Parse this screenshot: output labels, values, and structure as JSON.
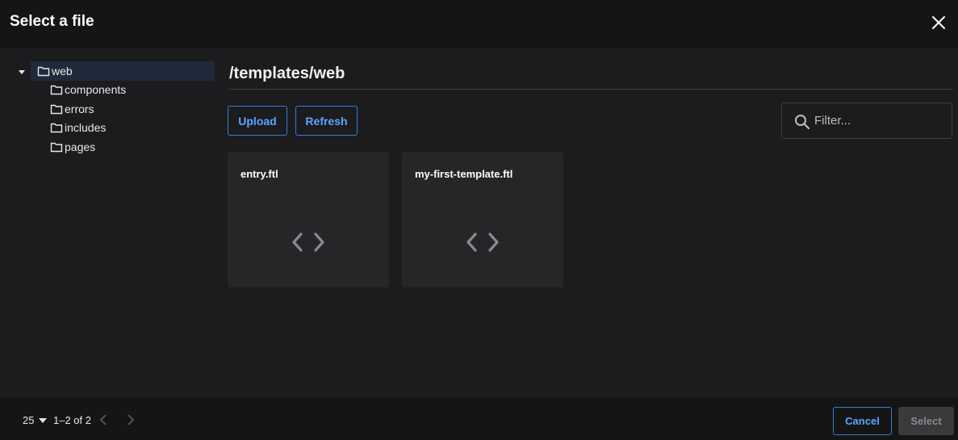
{
  "dialog": {
    "title": "Select a file"
  },
  "tree": {
    "root": {
      "label": "web",
      "expanded": true,
      "selected": true
    },
    "children": [
      {
        "label": "components"
      },
      {
        "label": "errors"
      },
      {
        "label": "includes"
      },
      {
        "label": "pages"
      }
    ]
  },
  "main": {
    "path": "/templates/web",
    "upload_label": "Upload",
    "refresh_label": "Refresh",
    "filter_placeholder": "Filter...",
    "files": [
      {
        "name": "entry.ftl",
        "icon": "code-icon"
      },
      {
        "name": "my-first-template.ftl",
        "icon": "code-icon"
      }
    ]
  },
  "footer": {
    "per_page": "25",
    "range": "1–2 of 2",
    "cancel_label": "Cancel",
    "select_label": "Select"
  },
  "colors": {
    "accent": "#5aa6ff",
    "background": "#1c1c1e",
    "header": "#151515",
    "card": "#262628",
    "selected_row": "#1f2a3a"
  }
}
